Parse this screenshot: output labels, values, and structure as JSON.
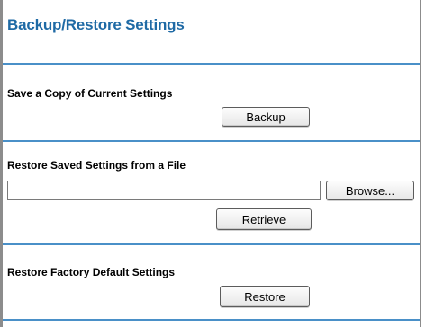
{
  "page": {
    "title": "Backup/Restore Settings"
  },
  "sections": {
    "save_copy": {
      "label": "Save a Copy of Current Settings",
      "button_label": "Backup"
    },
    "restore_file": {
      "label": "Restore Saved Settings from a File",
      "file_value": "",
      "browse_label": "Browse...",
      "button_label": "Retrieve"
    },
    "factory_default": {
      "label": "Restore Factory Default Settings",
      "button_label": "Restore"
    }
  },
  "colors": {
    "title": "#1f6aa5",
    "divider": "#4a90c8",
    "frame": "#8c8c8c"
  }
}
